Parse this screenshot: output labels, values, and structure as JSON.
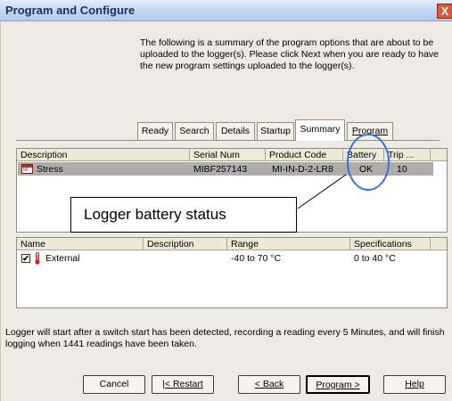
{
  "window": {
    "title": "Program and Configure",
    "close_glyph": "X"
  },
  "intro_text": "The following is a summary of the program options that are about to be uploaded to the logger(s). Please click Next when you are ready to have the new program settings uploaded to the logger(s).",
  "tabs": [
    {
      "label": "Ready"
    },
    {
      "label": "Search"
    },
    {
      "label": "Details"
    },
    {
      "label": "Startup"
    },
    {
      "label": "Summary"
    },
    {
      "label": "Program"
    }
  ],
  "logger_table": {
    "columns": [
      "Description",
      "Serial Num",
      "Product Code",
      "Battery",
      "Trip ..."
    ],
    "rows": [
      {
        "description": "Stress",
        "serial": "MIBF257143",
        "product_code": "MI-IN-D-2-LR8",
        "battery": "OK",
        "trip": "10",
        "icon": "logger-icon"
      }
    ]
  },
  "callout": {
    "text": "Logger battery status",
    "highlight_color": "#3b6ee8"
  },
  "channel_table": {
    "columns": [
      "Name",
      "Description",
      "Range",
      "Specifications"
    ],
    "rows": [
      {
        "checked": true,
        "check_glyph": "✔",
        "icon": "thermometer-icon",
        "name": "External",
        "description": "",
        "range": "-40 to 70 °C",
        "specifications": "0 to 40 °C"
      }
    ]
  },
  "footnote": "Logger will start after a switch start has been detected, recording a reading every 5 Minutes, and will finish logging when 1441 readings have been taken.",
  "buttons": {
    "cancel": "Cancel",
    "restart": "|< Restart",
    "back": "< Back",
    "program": "Program >",
    "help": "Help"
  }
}
